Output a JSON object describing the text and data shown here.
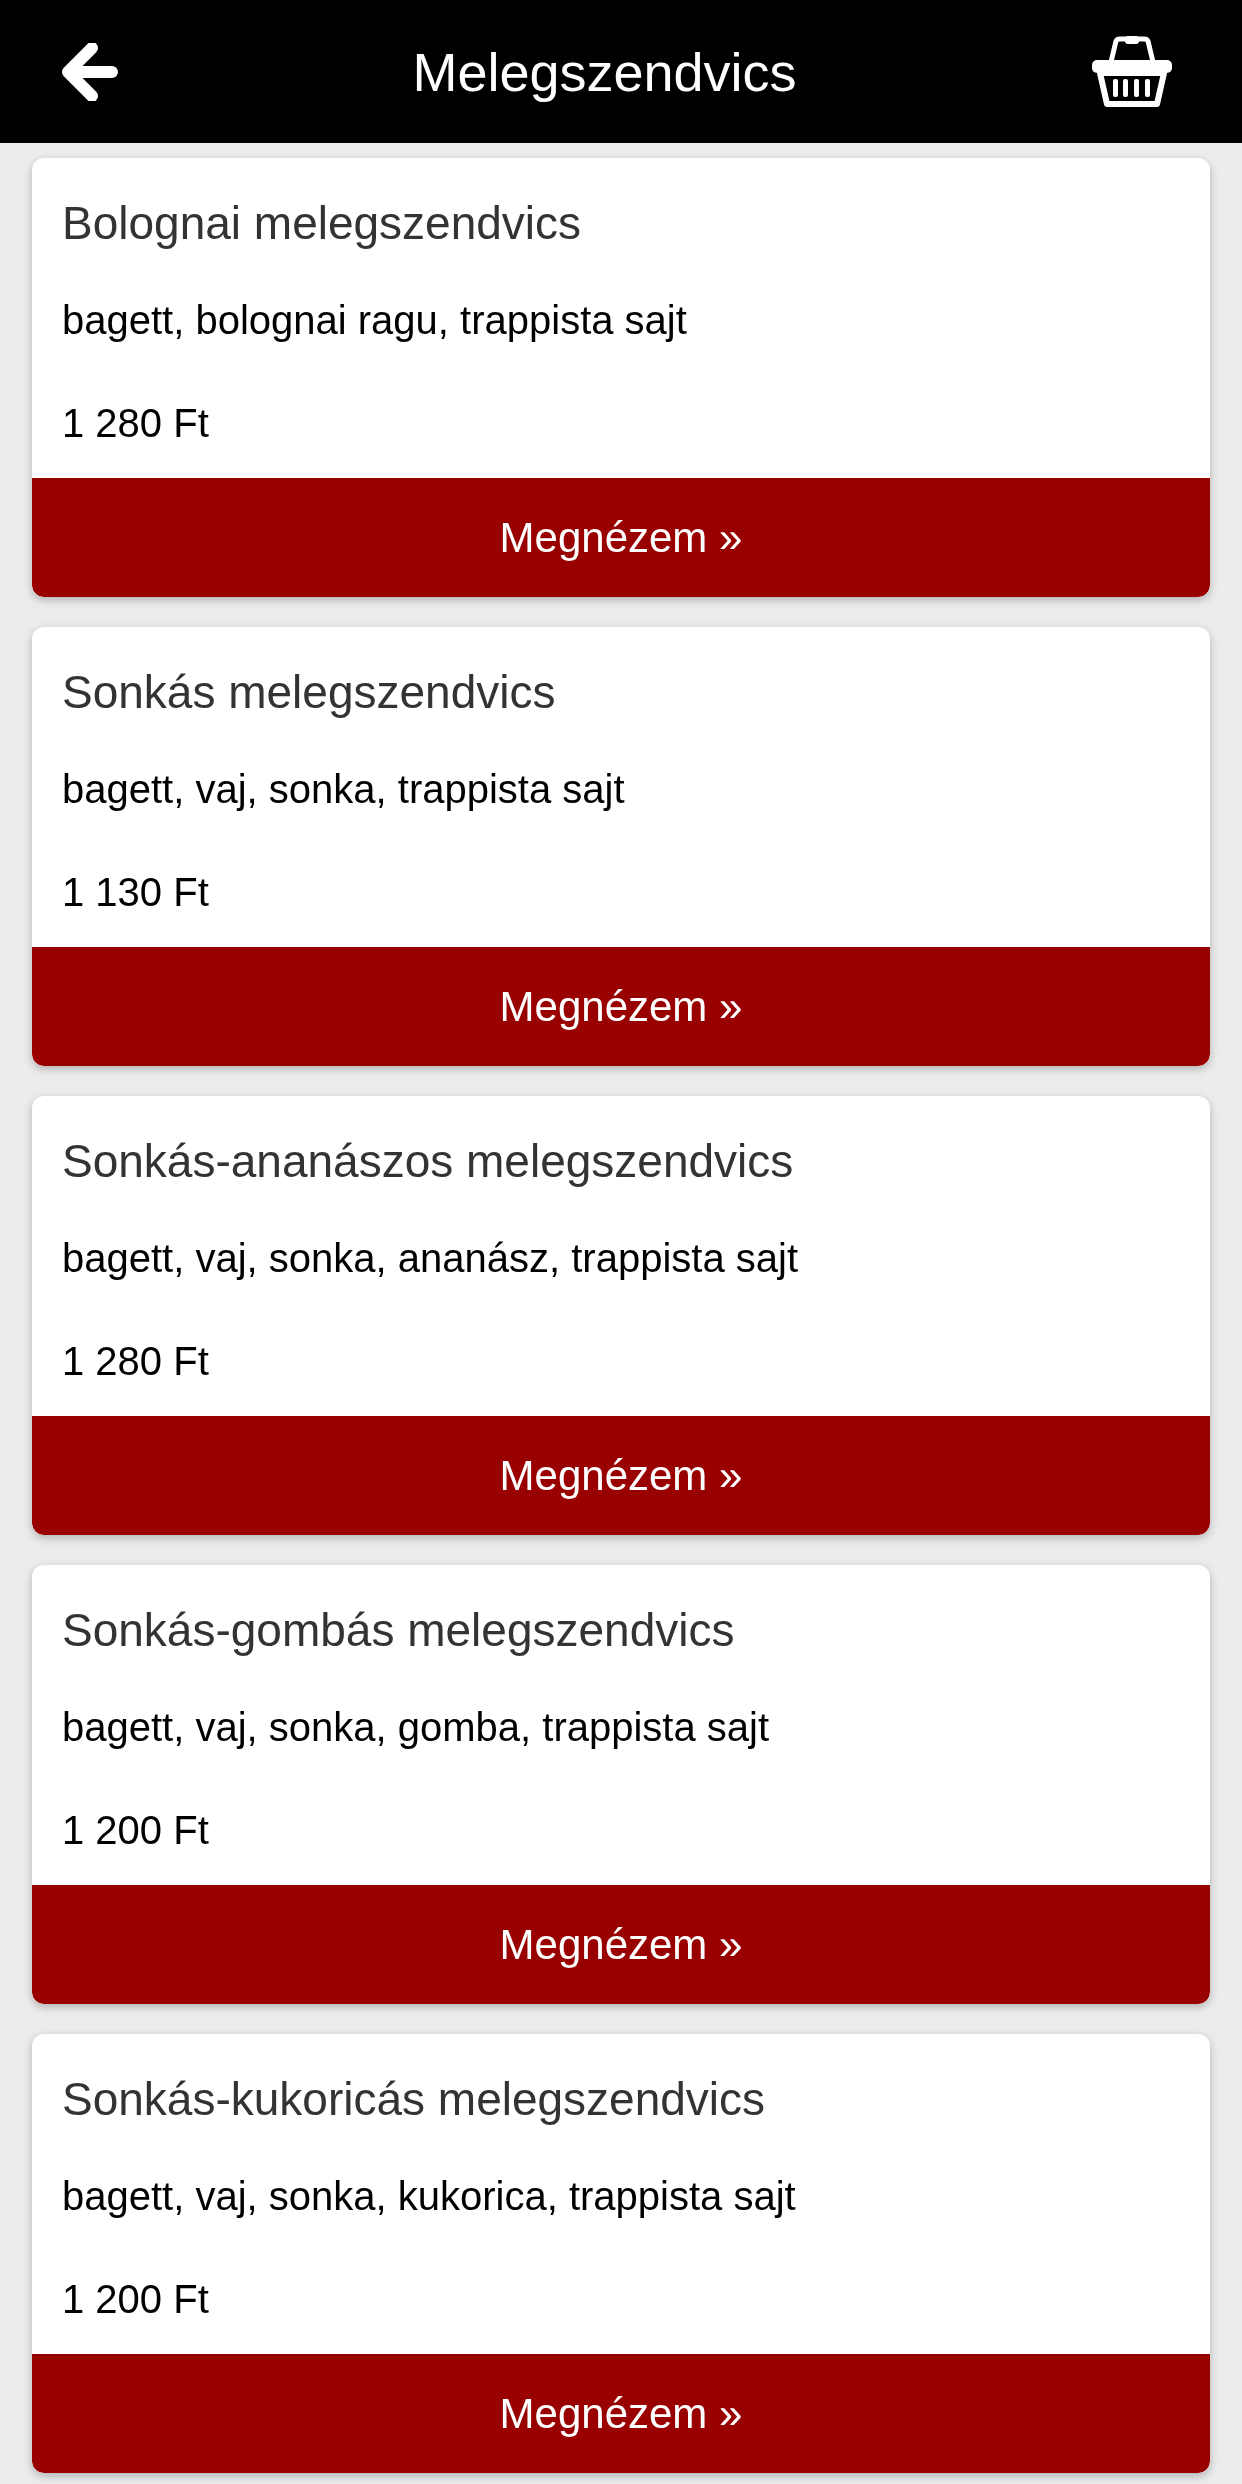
{
  "header": {
    "title": "Melegszendvics"
  },
  "products": [
    {
      "name": "Bolognai melegszendvics",
      "ingredients": "bagett, bolognai ragu, trappista sajt",
      "price": "1 280 Ft",
      "button": "Megnézem »"
    },
    {
      "name": "Sonkás melegszendvics",
      "ingredients": "bagett, vaj, sonka, trappista sajt",
      "price": "1 130 Ft",
      "button": "Megnézem »"
    },
    {
      "name": "Sonkás-ananászos melegszendvics",
      "ingredients": "bagett, vaj, sonka, ananász, trappista sajt",
      "price": "1 280 Ft",
      "button": "Megnézem »"
    },
    {
      "name": "Sonkás-gombás melegszendvics",
      "ingredients": "bagett, vaj, sonka, gomba, trappista sajt",
      "price": "1 200 Ft",
      "button": "Megnézem »"
    },
    {
      "name": "Sonkás-kukoricás melegszendvics",
      "ingredients": "bagett, vaj, sonka, kukorica, trappista sajt",
      "price": "1 200 Ft",
      "button": "Megnézem »"
    }
  ]
}
